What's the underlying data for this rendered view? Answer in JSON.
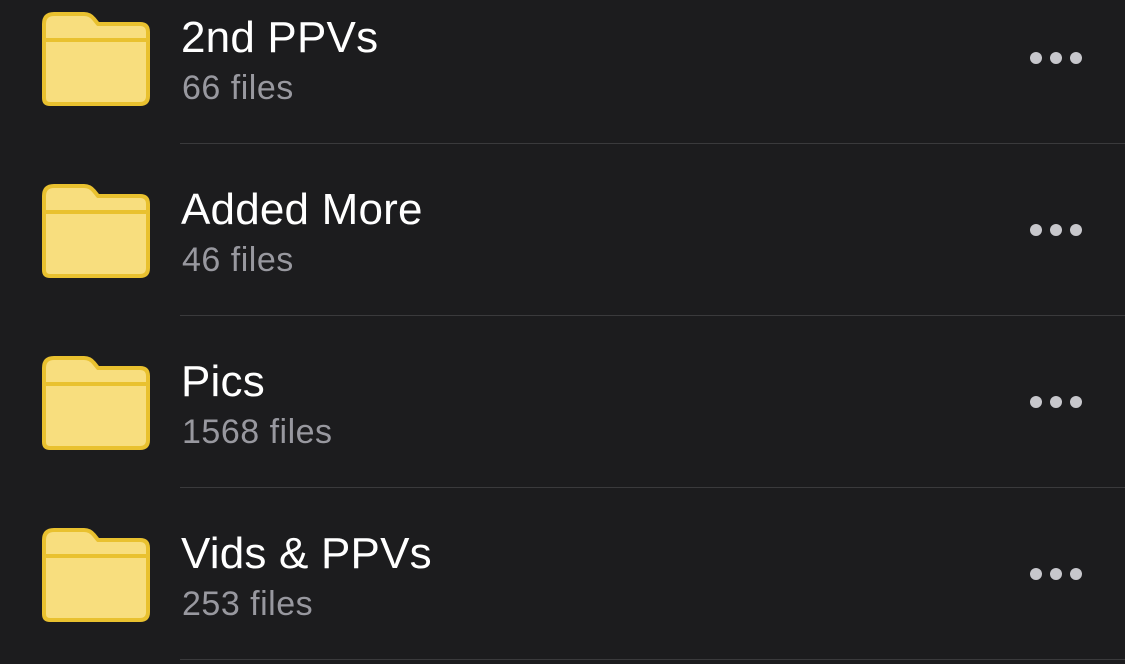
{
  "theme": {
    "background": "#1c1c1e",
    "folder_fill": "#f8de7e",
    "folder_stroke": "#e9c12f",
    "title_color": "#ffffff",
    "subtitle_color": "#98989f",
    "separator_color": "#3a3a3c"
  },
  "folders": [
    {
      "name": "2nd PPVs",
      "count": "66 files",
      "icon": "folder-icon",
      "action_icon": "more-icon"
    },
    {
      "name": "Added More",
      "count": "46 files",
      "icon": "folder-icon",
      "action_icon": "more-icon"
    },
    {
      "name": "Pics",
      "count": "1568 files",
      "icon": "folder-icon",
      "action_icon": "more-icon"
    },
    {
      "name": "Vids & PPVs",
      "count": "253 files",
      "icon": "folder-icon",
      "action_icon": "more-icon"
    }
  ]
}
